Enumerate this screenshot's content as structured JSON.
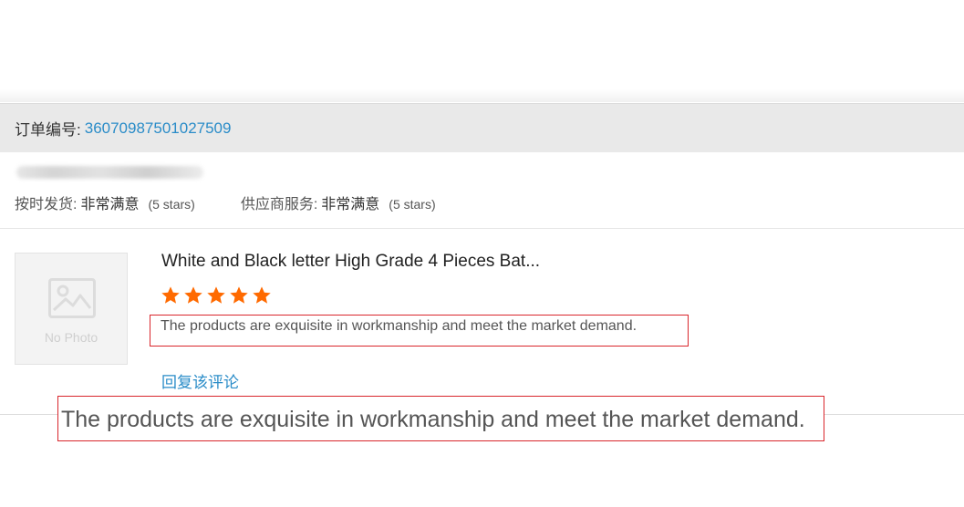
{
  "order": {
    "label": "订单编号:",
    "number": "36070987501027509"
  },
  "ratings": [
    {
      "label": "按时发货:",
      "value": "非常满意",
      "stars_text": "(5 stars)"
    },
    {
      "label": "供应商服务:",
      "value": "非常满意",
      "stars_text": "(5 stars)"
    }
  ],
  "product": {
    "photo_caption": "No Photo",
    "title": "White and Black letter High Grade 4 Pieces Bat...",
    "rating": 5,
    "rating_max": 5,
    "star_color": "#ff6a00",
    "review": "The products are exquisite in workmanship and meet the market demand.",
    "reply_label": "回复该评论"
  },
  "zoom": {
    "text": "The products are exquisite in workmanship and meet the market demand."
  },
  "colors": {
    "link": "#2a8cc8",
    "highlight_border": "#d9262c",
    "header_bg": "#e9e9e9"
  }
}
